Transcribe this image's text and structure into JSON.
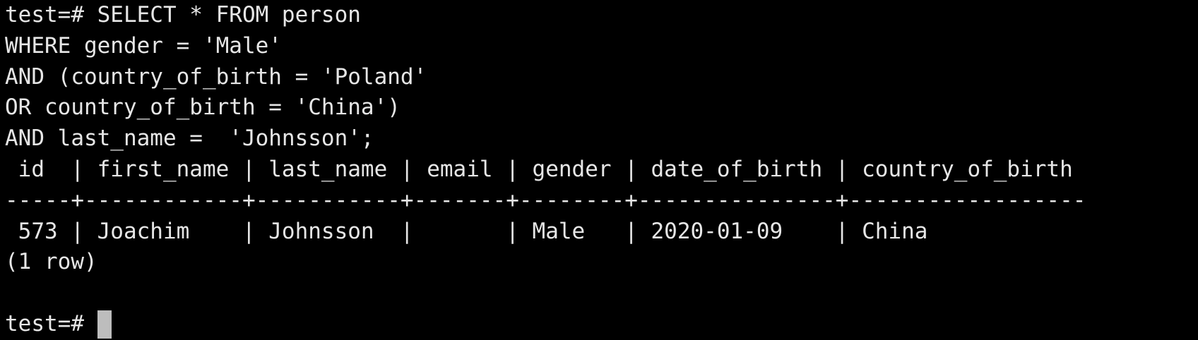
{
  "terminal": {
    "query_lines": [
      "test=# SELECT * FROM person",
      "WHERE gender = 'Male'",
      "AND (country_of_birth = 'Poland'",
      "OR country_of_birth = 'China')",
      "AND last_name =  'Johnsson';"
    ],
    "table_header": " id  | first_name | last_name | email | gender | date_of_birth | country_of_birth",
    "table_separator": "-----+------------+-----------+-------+--------+---------------+------------------",
    "table_rows": [
      " 573 | Joachim    | Johnsson  |       | Male   | 2020-01-09    | China"
    ],
    "row_count": "(1 row)",
    "blank": "",
    "prompt": "test=# "
  },
  "colors": {
    "background": "#000000",
    "text": "#e6e6e6",
    "cursor": "#bdbdbd"
  }
}
